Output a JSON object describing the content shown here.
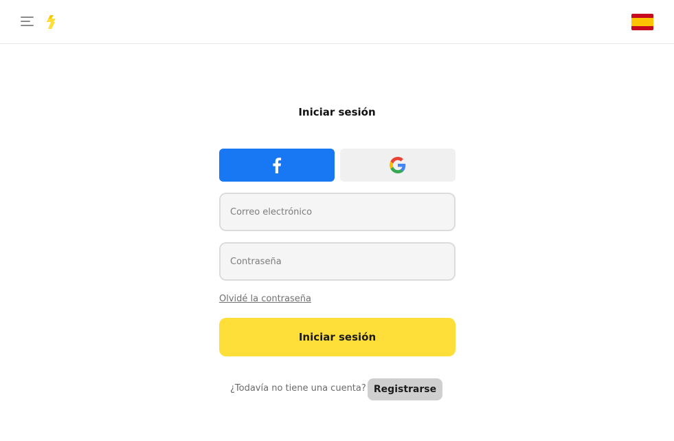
{
  "header": {
    "menu_icon": "hamburger-menu-icon",
    "logo_icon": "bolt-logo-icon",
    "language_flag": "spain-flag-icon",
    "brand_color": "#fedf3a"
  },
  "login": {
    "title": "Iniciar sesión",
    "facebook_icon": "facebook-icon",
    "facebook_color": "#1877f2",
    "google_icon": "google-icon",
    "email_placeholder": "Correo electrónico",
    "password_placeholder": "Contraseña",
    "forgot_password": "Olvidé la contraseña",
    "submit_label": "Iniciar sesión",
    "no_account_text": "¿Todavía no tiene una cuenta?",
    "register_label": "Registrarse"
  }
}
